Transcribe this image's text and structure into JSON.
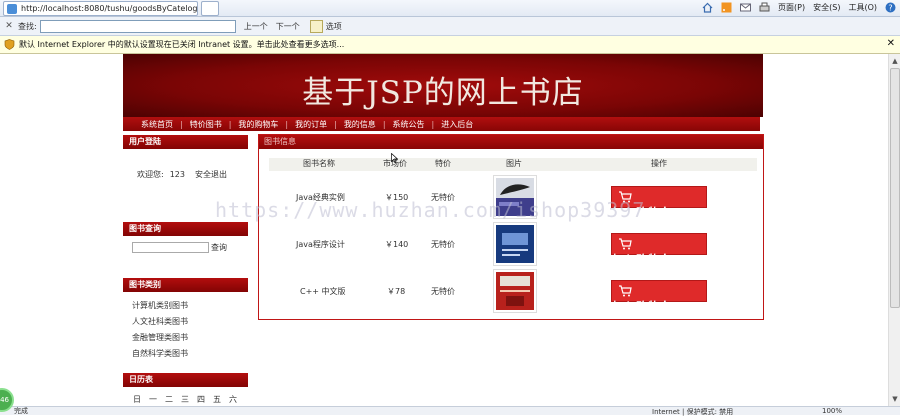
{
  "browser": {
    "tab_url": "http://localhost:8080/tushu/goodsByCatelog...",
    "commands": [
      "页面(P)",
      "安全(S)",
      "工具(O)"
    ],
    "find_label": "查找:",
    "find_value": "",
    "find_prev": "上一个",
    "find_next": "下一个",
    "find_options": "选项",
    "info_bar_text": "默认 Internet Explorer 中的默认设置现在已关闭 Intranet 设置。单击此处查看更多选项...",
    "status_left": "完成",
    "status_zone": "Internet | 保护模式: 禁用",
    "zoom": "100%",
    "side_badge": "46"
  },
  "site": {
    "title": "基于JSP的网上书店",
    "nav": [
      "系统首页",
      "特价图书",
      "我的购物车",
      "我的订单",
      "我的信息",
      "系统公告",
      "进入后台"
    ]
  },
  "sidebar": {
    "login_title": "用户登陆",
    "welcome_label": "欢迎您:",
    "username": "123",
    "logout": "安全退出",
    "search_title": "图书查询",
    "search_button": "查询",
    "category_title": "图书类别",
    "categories": [
      "计算机类别图书",
      "人文社科类图书",
      "金融管理类图书",
      "自然科学类图书"
    ],
    "calendar_title": "日历表",
    "weekdays": [
      "日",
      "一",
      "二",
      "三",
      "四",
      "五",
      "六"
    ]
  },
  "main": {
    "panel_title": "图书信息",
    "columns": [
      "图书名称",
      "市场价",
      "特价",
      "图片",
      "操作"
    ],
    "books": [
      {
        "name": "Java经典实例",
        "price": "￥150",
        "special": "无特价",
        "cart": "加入购物车"
      },
      {
        "name": "Java程序设计",
        "price": "￥140",
        "special": "无特价",
        "cart": "加入购物车"
      },
      {
        "name": "C++ 中文版",
        "price": "￥78",
        "special": "无特价",
        "cart": "加入购物车"
      }
    ]
  },
  "watermark": "https://www.huzhan.com/ishop39397"
}
